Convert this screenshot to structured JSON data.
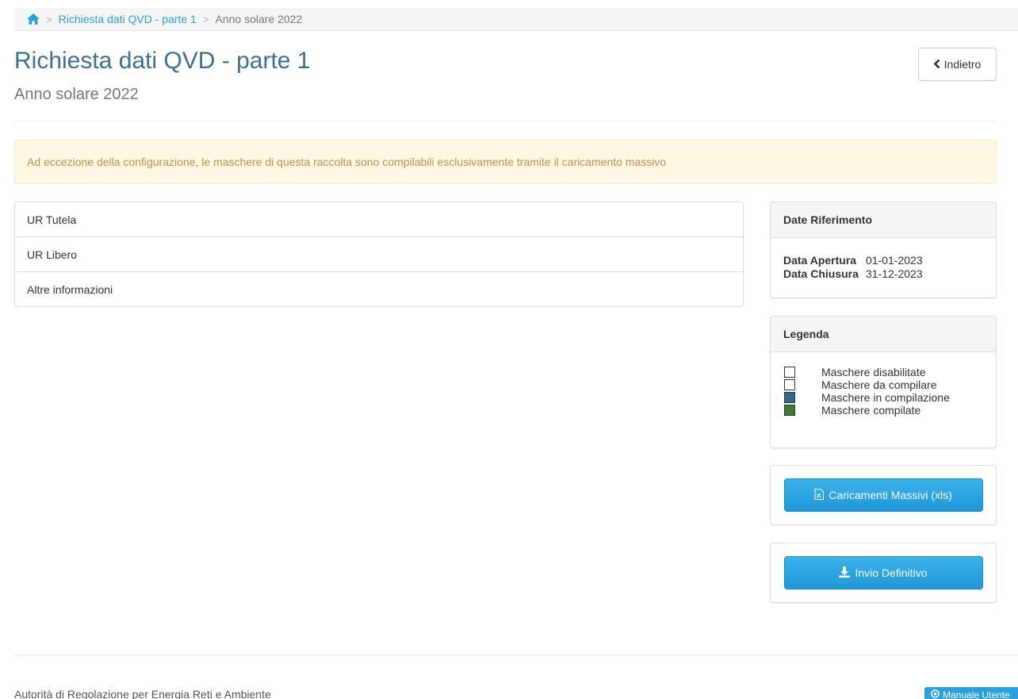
{
  "breadcrumb": {
    "items": [
      {
        "label": "Richiesta dati QVD - parte 1",
        "link": true
      },
      {
        "label": "Anno solare 2022",
        "link": false
      }
    ]
  },
  "header": {
    "title": "Richiesta dati QVD - parte 1",
    "subtitle": "Anno solare 2022",
    "back_label": "Indietro"
  },
  "alert": {
    "text": "Ad eccezione della configurazione, le maschere di questa raccolta sono compilabili esclusivamente tramite il caricamento massivo"
  },
  "sections": [
    {
      "label": "UR Tutela"
    },
    {
      "label": "UR Libero"
    },
    {
      "label": "Altre informazioni"
    }
  ],
  "dates_panel": {
    "title": "Date Riferimento",
    "opening_label": "Data Apertura",
    "opening_value": "01-01-2023",
    "closing_label": "Data Chiusura",
    "closing_value": "31-12-2023"
  },
  "legend_panel": {
    "title": "Legenda",
    "items": [
      {
        "label": "Maschere disabilitate",
        "color": "#ffffff"
      },
      {
        "label": "Maschere da compilare",
        "color": "#ffffff"
      },
      {
        "label": "Maschere in compilazione",
        "color": "#2e6a8a"
      },
      {
        "label": "Maschere compilate",
        "color": "#3c7a3a"
      }
    ]
  },
  "actions": {
    "bulk_upload_label": "Caricamenti Massivi (xls)",
    "final_submit_label": "Invio Definitivo"
  },
  "footer": {
    "text": "Autorità di Regolazione per Energia Reti e Ambiente",
    "manual_label": "Manuale Utente"
  },
  "colors": {
    "accent": "#2aa0dc",
    "title": "#3b6f96",
    "alert_bg": "#fcf8e3",
    "alert_text": "#c0914a"
  }
}
